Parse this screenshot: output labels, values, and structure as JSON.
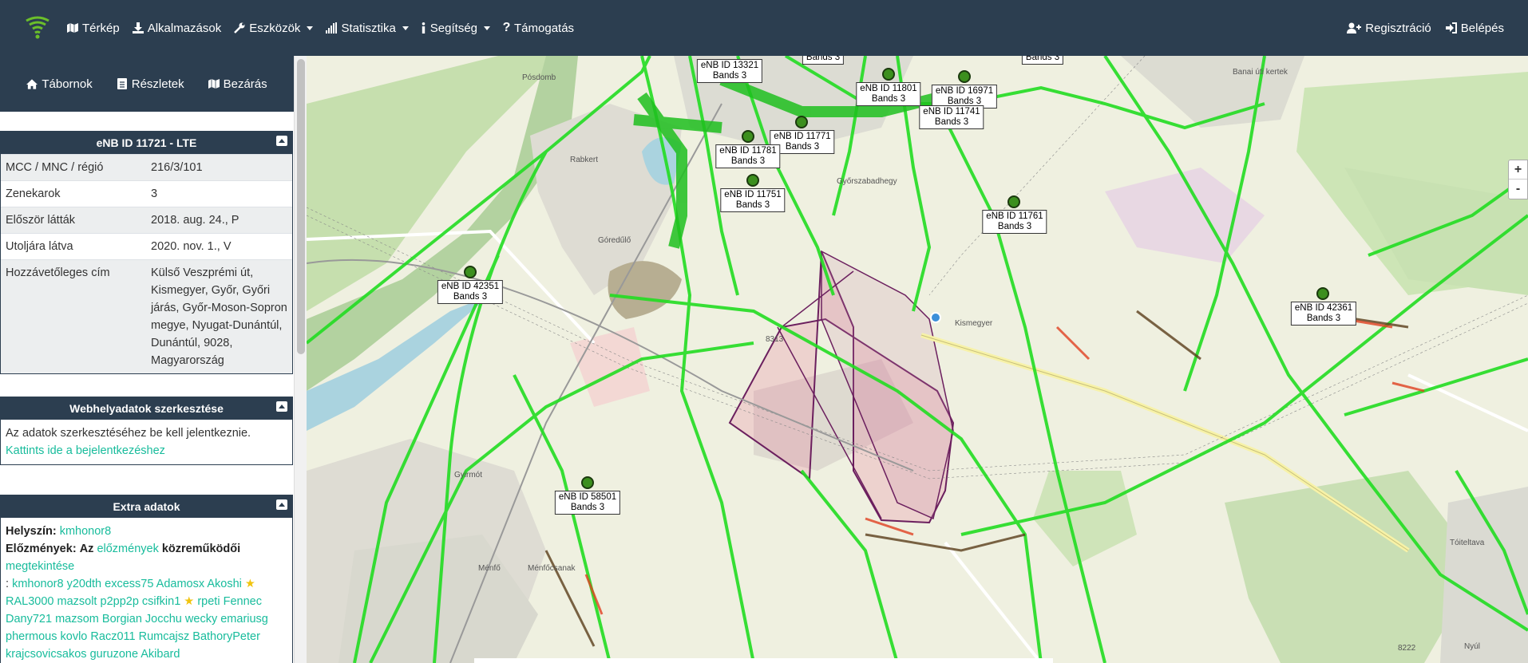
{
  "navbar": {
    "items": [
      {
        "label": "Térkép",
        "icon": "map-icon"
      },
      {
        "label": "Alkalmazások",
        "icon": "download-icon"
      },
      {
        "label": "Eszközök",
        "icon": "wrench-icon",
        "dropdown": true
      },
      {
        "label": "Statisztika",
        "icon": "signal-icon",
        "dropdown": true
      },
      {
        "label": "Segítség",
        "icon": "info-icon",
        "dropdown": true
      },
      {
        "label": "Támogatás",
        "icon": "question-icon"
      }
    ],
    "right": [
      {
        "label": "Regisztráció",
        "icon": "user-plus-icon"
      },
      {
        "label": "Belépés",
        "icon": "sign-in-icon"
      }
    ]
  },
  "sidebar_nav": [
    {
      "label": "Tábornok",
      "icon": "home-icon"
    },
    {
      "label": "Részletek",
      "icon": "file-icon"
    },
    {
      "label": "Bezárás",
      "icon": "map-icon"
    }
  ],
  "cell_panel": {
    "title": "eNB ID 11721 - LTE",
    "rows": [
      {
        "key": "MCC / MNC / régió",
        "value": "216/3/101"
      },
      {
        "key": "Zenekarok",
        "value": "3"
      },
      {
        "key": "Először látták",
        "value": "2018. aug. 24., P"
      },
      {
        "key": "Utoljára látva",
        "value": "2020. nov. 1., V"
      },
      {
        "key": "Hozzávetőleges cím",
        "value": "Külső Veszprémi út, Kismegyer, Győr, Győri járás, Győr-Moson-Sopron megye, Nyugat-Dunántúl, Dunántúl, 9028, Magyarország"
      }
    ]
  },
  "edit_panel": {
    "title": "Webhelyadatok szerkesztése",
    "text": "Az adatok szerkesztéséhez be kell jelentkeznie.",
    "link": "Kattints ide a bejelentkezéshez"
  },
  "extra_panel": {
    "title": "Extra adatok",
    "location_label": "Helyszín:",
    "location_value": "kmhonor8",
    "history_label": "Előzmények:",
    "history_az": "Az",
    "history_link": "előzmények",
    "contrib_label": "közreműködői",
    "view_link": "megtekintése",
    "contributors": [
      "kmhonor8",
      "y20dth",
      "excess75",
      "Adamosx",
      "Akoshi",
      "RAL3000",
      "mazsolt",
      "p2pp2p",
      "csifkin1",
      "rpeti",
      "Fennec",
      "Dany721",
      "mazsom",
      "Borgian",
      "Jocchu",
      "wecky",
      "emariusg",
      "phermous",
      "kovlo",
      "Racz011",
      "Rumcajsz",
      "BathoryPeter",
      "krajcsovicsakos",
      "guruzone",
      "Akibard"
    ],
    "starred": [
      "Akoshi",
      "csifkin1"
    ]
  },
  "map": {
    "zoom_in": "+",
    "zoom_out": "-",
    "cells": [
      {
        "id": "eNB ID 13321",
        "bands": "Bands 3",
        "dot": false
      },
      {
        "id": "eNB ID 11801",
        "bands": "Bands 3",
        "dot": true
      },
      {
        "id": "eNB ID 16971",
        "bands": "Bands 3",
        "dot": true
      },
      {
        "id": "eNB ID 11741",
        "bands": "Bands 3",
        "dot": false
      },
      {
        "id": "eNB ID 11771",
        "bands": "Bands 3",
        "dot": true
      },
      {
        "id": "eNB ID 11781",
        "bands": "Bands 3",
        "dot": true
      },
      {
        "id": "eNB ID 11751",
        "bands": "Bands 3",
        "dot": true
      },
      {
        "id": "eNB ID 11761",
        "bands": "Bands 3",
        "dot": true
      },
      {
        "id": "eNB ID 42351",
        "bands": "Bands 3",
        "dot": true
      },
      {
        "id": "eNB ID 42361",
        "bands": "Bands 3",
        "dot": true
      },
      {
        "id": "eNB ID 58501",
        "bands": "Bands 3",
        "dot": true
      },
      {
        "id": "",
        "bands": "Bands 3",
        "dot": false
      },
      {
        "id": "",
        "bands": "Bands 3",
        "dot": false
      }
    ],
    "places": [
      "Rabkert",
      "Góredűlő",
      "Gyirmót",
      "Ménfő",
      "Ménfőcsanak",
      "Kismegyer",
      "Tóiteltava",
      "Pósdomb",
      "Banai úti kertek",
      "Győrszabadhegy",
      "Nyúl",
      "8222",
      "8313"
    ]
  },
  "colors": {
    "navbar": "#2c3e50",
    "link": "#18bc9c",
    "polygon": "#6b1f5e"
  }
}
